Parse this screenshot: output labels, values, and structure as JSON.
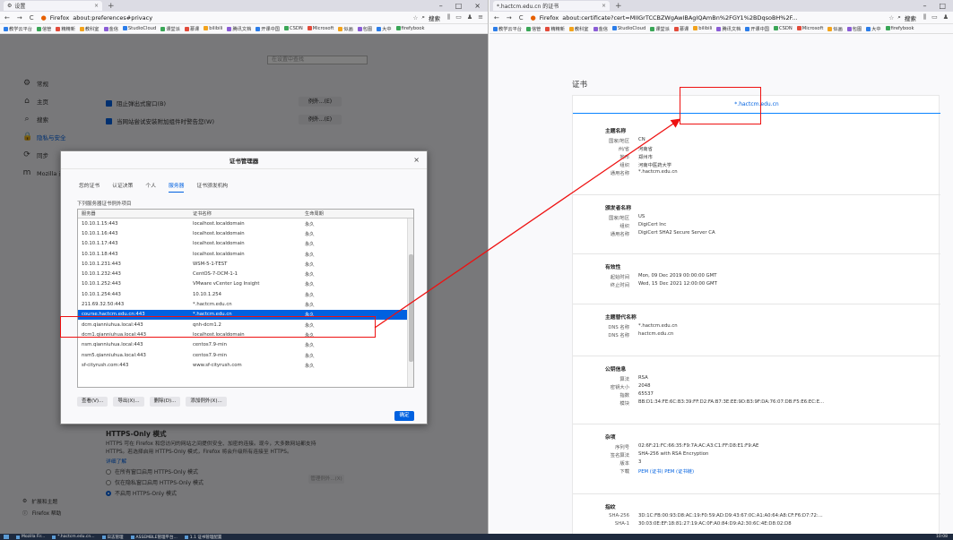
{
  "left_window": {
    "tab_title": "设置",
    "url_brand": "Firefox",
    "url": "about:preferences#privacy",
    "search_label": "搜索",
    "bookmarks": [
      "教学云平台",
      "信管",
      "精精新",
      "教科室",
      "金信",
      "StudioCloud",
      "课堂派",
      "慕课",
      "bilibili",
      "腾讯文档",
      "开课中国",
      "CSDN",
      "Microsoft",
      "似画",
      "包图",
      "大中",
      "firefybook"
    ],
    "find_placeholder": "在设置中查找",
    "sidebar": [
      {
        "icon": "gear-icon",
        "glyph": "⚙",
        "label": "常规"
      },
      {
        "icon": "home-icon",
        "glyph": "⌂",
        "label": "主页"
      },
      {
        "icon": "search-icon",
        "glyph": "⌕",
        "label": "搜索"
      },
      {
        "icon": "lock-icon",
        "glyph": "🔒",
        "label": "隐私与安全"
      },
      {
        "icon": "sync-icon",
        "glyph": "⟳",
        "label": "同步"
      },
      {
        "icon": "mozilla-icon",
        "glyph": "m",
        "label": "Mozilla 产品"
      }
    ],
    "pref_rows": [
      {
        "label": "阻止弹出式窗口(B)",
        "button": "例外...(E)"
      },
      {
        "label": "当网站尝试安装附加组件时警告您(W)",
        "button": "例外...(E)"
      }
    ],
    "https_only": {
      "title": "HTTPS-Only 模式",
      "desc1": "HTTPS 可在 Firefox 和您访问的网站之间提供安全、加密的连接。现今，大多数网站都支持",
      "desc2": "HTTPS。若选择启用 HTTPS-Only 模式，Firefox 将会升级所有连接至 HTTPS。",
      "learn_more": "详细了解",
      "options": [
        "在所有窗口启用 HTTPS-Only 模式",
        "仅在隐私窗口启用 HTTPS-Only 模式",
        "不启用 HTTPS-Only 模式"
      ],
      "selected": 2,
      "manage_button": "管理例外...(X)"
    },
    "sidebar_bottom": [
      {
        "icon": "puzzle-icon",
        "glyph": "⚙",
        "label": "扩展和主题"
      },
      {
        "icon": "help-icon",
        "glyph": "ⓘ",
        "label": "Firefox 帮助"
      }
    ]
  },
  "dialog": {
    "title": "证书管理器",
    "tabs": [
      "您的证书",
      "认证决策",
      "个人",
      "服务器",
      "证书颁发机构"
    ],
    "active_tab": 3,
    "description": "下列服务器证书例外项目",
    "columns": [
      "服务器",
      "证书名称",
      "生命周期"
    ],
    "rows": [
      [
        "10.10.1.15:443",
        "localhost.localdomain",
        "永久"
      ],
      [
        "10.10.1.16:443",
        "localhost.localdomain",
        "永久"
      ],
      [
        "10.10.1.17:443",
        "localhost.localdomain",
        "永久"
      ],
      [
        "10.10.1.18:443",
        "localhost.localdomain",
        "永久"
      ],
      [
        "10.10.1.231:443",
        "WSM-5-1-TEST",
        "永久"
      ],
      [
        "10.10.1.232:443",
        "CentOS-7-DCM-1-1",
        "永久"
      ],
      [
        "10.10.1.252:443",
        "VMware vCenter Log Insight",
        "永久"
      ],
      [
        "10.10.1.254:443",
        "10.10.1.254",
        "永久"
      ],
      [
        "211.69.32.50:443",
        "*.hactcm.edu.cn",
        "永久"
      ],
      [
        "course.hactcm.edu.cn:443",
        "*.hactcm.edu.cn",
        "永久"
      ],
      [
        "dcm.qianniuhua.local:443",
        "qnh-dcm1.2",
        "永久"
      ],
      [
        "dcm1.qianniuhua.local:443",
        "localhost.localdomain",
        "永久"
      ],
      [
        "nsm.qianniuhua.local:443",
        "centos7.9-min",
        "永久"
      ],
      [
        "nsm5.qianniuhua.local:443",
        "centos7.9-min",
        "永久"
      ],
      [
        "sf-cityrush.com:443",
        "www.sf-cityrush.com",
        "永久"
      ]
    ],
    "selected_row": 9,
    "buttons": [
      "查看(V)...",
      "导出(X)...",
      "删除(D)...",
      "添加例外(X)..."
    ],
    "ok": "确定"
  },
  "right_window": {
    "tab_title": "*.hactcm.edu.cn 的证书",
    "url_brand": "Firefox",
    "url": "about:certificate?cert=MIIGrTCCBZWgAwIBAgIQAmBn%2FGY1%2BDqsoBH%2F...",
    "search_label": "搜索",
    "bookmarks": [
      "教学云平台",
      "信管",
      "精精新",
      "教科室",
      "金信",
      "StudioCloud",
      "课堂派",
      "慕课",
      "bilibili",
      "腾讯文档",
      "开课中国",
      "CSDN",
      "Microsoft",
      "似画",
      "包图",
      "大中",
      "firefybook"
    ],
    "page_title": "证书",
    "cert_cn": "*.hactcm.edu.cn",
    "sections": [
      {
        "title": "主题名称",
        "fields": [
          [
            "国家/地区",
            "CN"
          ],
          [
            "州/省",
            "河南省"
          ],
          [
            "地市",
            "郑州市"
          ],
          [
            "组织",
            "河南中医药大学"
          ],
          [
            "通用名称",
            "*.hactcm.edu.cn"
          ]
        ]
      },
      {
        "title": "颁发者名称",
        "fields": [
          [
            "国家/地区",
            "US"
          ],
          [
            "组织",
            "DigiCert Inc"
          ],
          [
            "通用名称",
            "DigiCert SHA2 Secure Server CA"
          ]
        ]
      },
      {
        "title": "有效性",
        "fields": [
          [
            "起始时间",
            "Mon, 09 Dec 2019 00:00:00 GMT"
          ],
          [
            "终止时间",
            "Wed, 15 Dec 2021 12:00:00 GMT"
          ]
        ]
      },
      {
        "title": "主题替代名称",
        "fields": [
          [
            "DNS 名称",
            "*.hactcm.edu.cn"
          ],
          [
            "DNS 名称",
            "hactcm.edu.cn"
          ]
        ]
      },
      {
        "title": "公钥信息",
        "fields": [
          [
            "算法",
            "RSA"
          ],
          [
            "密钥大小",
            "2048"
          ],
          [
            "指数",
            "65537"
          ],
          [
            "模块",
            "BB:D1:34:FE:6C:B3:39:FF:D2:FA:B7:3E:EE:9D:B3:9F:DA:76:07:DB:F5:E6:EC:E..."
          ]
        ]
      },
      {
        "title": "杂项",
        "fields": [
          [
            "序列号",
            "02:6F:21:FC:66:35:F9:7A:AC:A3:C1:FF:D8:E1:F9:AE"
          ],
          [
            "签名算法",
            "SHA-256 with RSA Encryption"
          ],
          [
            "版本",
            "3"
          ],
          [
            "下载",
            "PEM (证书)  PEM (证书链)"
          ]
        ]
      },
      {
        "title": "指纹",
        "fields": [
          [
            "SHA-256",
            "3D:1C:FB:00:93:D8:AC:19:F0:59:AD:D9:43:67:0C:A1:A0:64:A8:CF:F6:D7:72:..."
          ],
          [
            "SHA-1",
            "30:03:0E:EF:18:81:27:19:AC:0F:A0:84:D9:A2:30:6C:4E:D8:02:D8"
          ]
        ]
      }
    ]
  },
  "taskbar": {
    "items": [
      "Mozilla Fir...",
      "*.hactcm.edu.cn...",
      "日志管理",
      "ASSEMBLE管理平台...",
      "1.1 证书管理配置"
    ],
    "clock": "10:08"
  },
  "colors": {
    "accent": "#0061e0",
    "highlight": "#e11111",
    "link": "#0a84ff"
  }
}
